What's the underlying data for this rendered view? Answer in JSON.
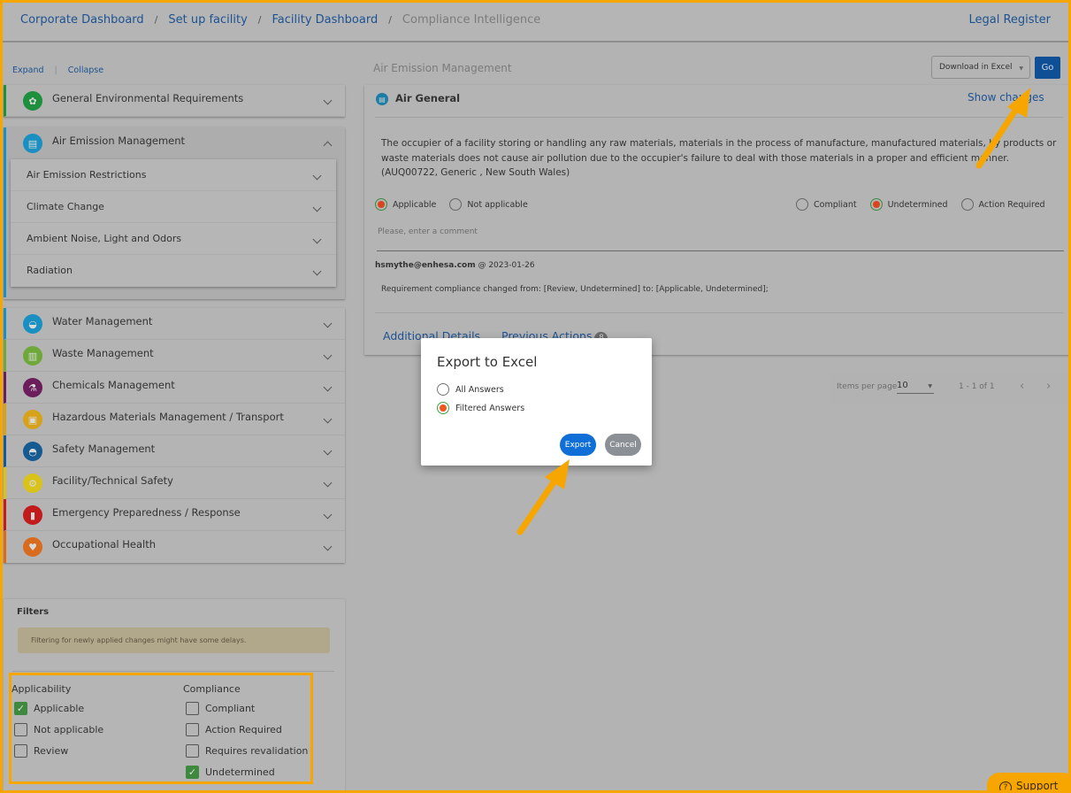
{
  "header": {
    "breadcrumb": [
      "Corporate Dashboard",
      "Set up facility",
      "Facility Dashboard"
    ],
    "breadcrumb_current": "Compliance Intelligence",
    "separator": "/",
    "legal_register": "Legal Register"
  },
  "sidebar": {
    "expand": "Expand",
    "collapse": "Collapse",
    "categories": [
      {
        "label": "General Environmental Requirements",
        "icon": "leaf-icon",
        "color": "#1e8f3c",
        "glyph": "✿"
      },
      {
        "label": "Air Emission Management",
        "icon": "factory-icon",
        "color": "#1a8fc1",
        "glyph": "▤",
        "expanded": true,
        "children": [
          "Air Emission Restrictions",
          "Climate Change",
          "Ambient Noise, Light and Odors",
          "Radiation"
        ]
      },
      {
        "label": "Water Management",
        "icon": "water-drop-icon",
        "color": "#1a8fc1",
        "glyph": "◒"
      },
      {
        "label": "Waste Management",
        "icon": "trash-bin-icon",
        "color": "#6fa83a",
        "glyph": "▥"
      },
      {
        "label": "Chemicals Management",
        "icon": "flask-icon",
        "color": "#6b1d5c",
        "glyph": "⚗"
      },
      {
        "label": "Hazardous Materials Management / Transport",
        "icon": "truck-icon",
        "color": "#d6a21a",
        "glyph": "▣"
      },
      {
        "label": "Safety Management",
        "icon": "hard-hat-icon",
        "color": "#155a91",
        "glyph": "◓"
      },
      {
        "label": "Facility/Technical Safety",
        "icon": "gear-icon",
        "color": "#d9c21a",
        "glyph": "⚙"
      },
      {
        "label": "Emergency Preparedness / Response",
        "icon": "fire-extinguisher-icon",
        "color": "#c11b1b",
        "glyph": "▮"
      },
      {
        "label": "Occupational Health",
        "icon": "heart-pulse-icon",
        "color": "#d86b1e",
        "glyph": "♥"
      }
    ]
  },
  "filters": {
    "title": "Filters",
    "notice": "Filtering for newly applied changes might have some delays.",
    "applicability": {
      "heading": "Applicability",
      "options": [
        {
          "label": "Applicable",
          "checked": true
        },
        {
          "label": "Not applicable",
          "checked": false
        },
        {
          "label": "Review",
          "checked": false
        }
      ]
    },
    "compliance": {
      "heading": "Compliance",
      "options": [
        {
          "label": "Compliant",
          "checked": false
        },
        {
          "label": "Action Required",
          "checked": false
        },
        {
          "label": "Requires revalidation",
          "checked": false
        },
        {
          "label": "Undetermined",
          "checked": true
        }
      ]
    }
  },
  "main": {
    "section_title": "Air Emission Management",
    "download_select": "Download in Excel",
    "go_label": "Go",
    "card": {
      "title": "Air General",
      "show_changes": "Show changes",
      "requirement_text": "The occupier of a facility storing or handling any raw materials, materials in the process of manufacture, manufactured materials, by products or waste materials does not cause air pollution due to the occupier's failure to deal with those materials in a proper and efficient manner.",
      "requirement_ref": "(AUQ00722, Generic , New South Wales)",
      "applicability_options": [
        {
          "label": "Applicable",
          "selected": true
        },
        {
          "label": "Not applicable",
          "selected": false
        }
      ],
      "compliance_options": [
        {
          "label": "Compliant",
          "selected": false
        },
        {
          "label": "Undetermined",
          "selected": true
        },
        {
          "label": "Action Required",
          "selected": false
        }
      ],
      "comment_placeholder": "Please, enter a comment",
      "log_user": "hsmythe@enhesa.com",
      "log_date": " @ 2023-01-26",
      "log_text": "Requirement compliance changed from: [Review, Undetermined] to: [Applicable, Undetermined];",
      "tab_additional": "Additional Details",
      "tab_previous": "Previous Actions",
      "previous_count": "8"
    },
    "pager": {
      "items_per_page_label": "Items per page",
      "items_per_page": "10",
      "range": "1 - 1 of 1"
    }
  },
  "modal": {
    "title": "Export to Excel",
    "options": [
      {
        "label": "All Answers",
        "selected": false
      },
      {
        "label": "Filtered Answers",
        "selected": true
      }
    ],
    "export": "Export",
    "cancel": "Cancel"
  },
  "support": {
    "label": "Support"
  },
  "colors": {
    "accent": "#f7a600",
    "link": "#1d5291",
    "primary_button": "#0f6fd6"
  }
}
